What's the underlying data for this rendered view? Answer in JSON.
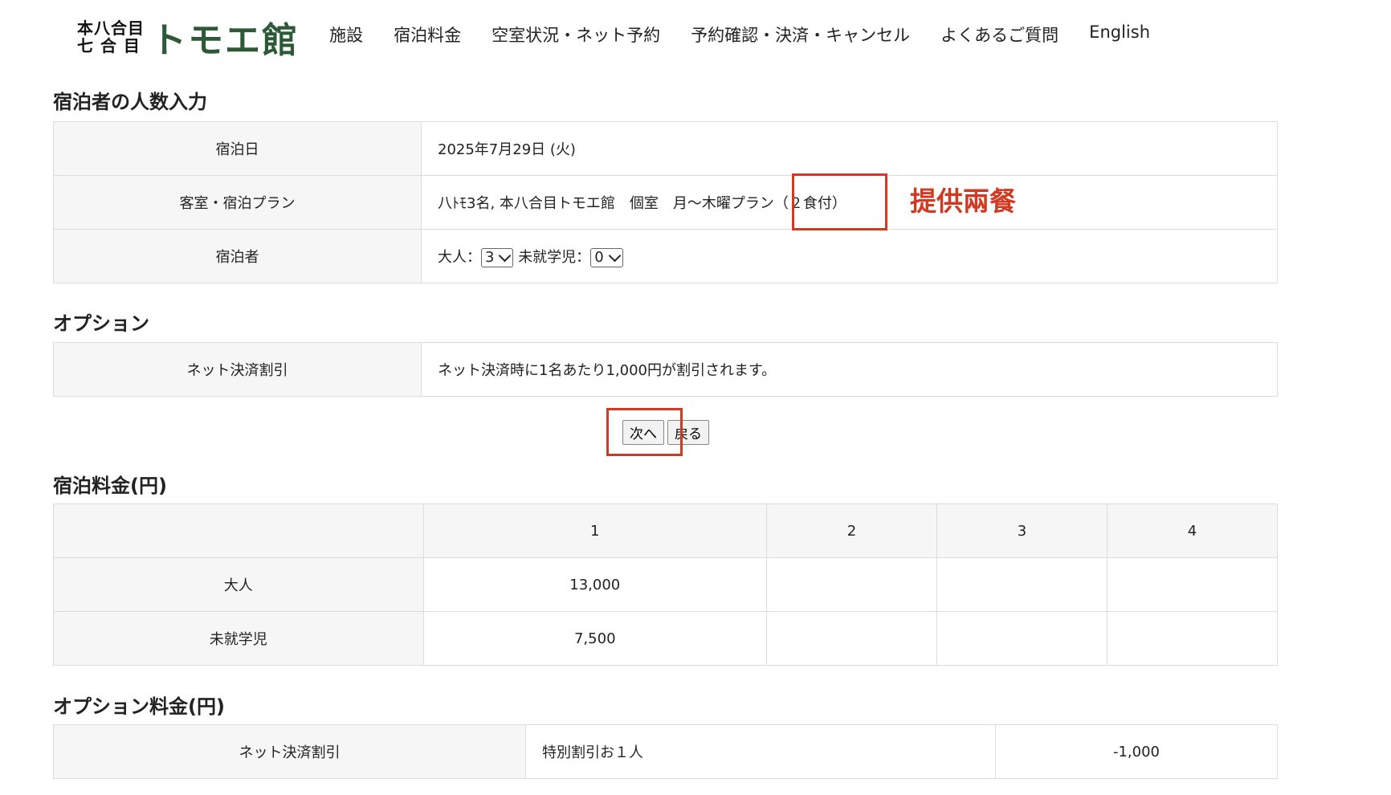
{
  "header": {
    "logo_small_line1": "本八合目",
    "logo_small_line2": "七 合 目",
    "logo_big": "トモエ館",
    "nav": [
      "施設",
      "宿泊料金",
      "空室状況・ネット予約",
      "予約確認・決済・キャンセル",
      "よくあるご質問",
      "English"
    ]
  },
  "guest_section": {
    "title": "宿泊者の人数入力",
    "rows": {
      "date_label": "宿泊日",
      "date_value": "2025年7月29日 (火)",
      "plan_label": "客室・宿泊プラン",
      "plan_value": "八ﾄﾓ3名, 本八合目トモエ館　個室　月〜木曜プラン（２食付）",
      "guests_label": "宿泊者",
      "adult_label": "大人：",
      "adult_value": "3",
      "child_label": "未就学児：",
      "child_value": "0"
    }
  },
  "option_section": {
    "title": "オプション",
    "label": "ネット決済割引",
    "value": "ネット決済時に1名あたり1,000円が割引されます。"
  },
  "buttons": {
    "next": "次へ",
    "back": "戻る"
  },
  "price_section": {
    "title": "宿泊料金(円)",
    "columns": [
      "1",
      "2",
      "3",
      "4"
    ],
    "rows": [
      {
        "label": "大人",
        "values": [
          "13,000",
          "",
          "",
          ""
        ]
      },
      {
        "label": "未就学児",
        "values": [
          "7,500",
          "",
          "",
          ""
        ]
      }
    ]
  },
  "option_price_section": {
    "title": "オプション料金(円)",
    "label": "ネット決済割引",
    "desc": "特別割引お１人",
    "amount": "-1,000"
  },
  "annotation": {
    "text": "提供兩餐",
    "color": "#d03a22"
  }
}
